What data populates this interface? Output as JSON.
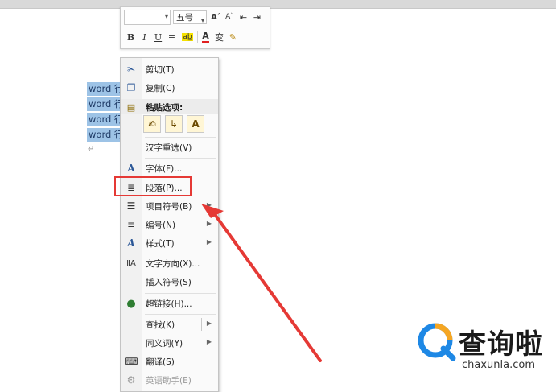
{
  "document": {
    "lines": [
      "word 行",
      "word 行",
      "word 行",
      "word 行"
    ],
    "paragraph_mark": "↵"
  },
  "mini_toolbar": {
    "font_value": "",
    "size_value": "五号",
    "row1_buttons": [
      {
        "name": "grow-font-button",
        "glyph": "A˄"
      },
      {
        "name": "shrink-font-button",
        "glyph": "A˅"
      },
      {
        "name": "decrease-indent-button",
        "glyph": "⇤"
      },
      {
        "name": "increase-indent-button",
        "glyph": "⇥"
      }
    ],
    "row2_buttons": [
      {
        "name": "bold-button",
        "glyph": "B"
      },
      {
        "name": "italic-button",
        "glyph": "I"
      },
      {
        "name": "underline-button",
        "glyph": "U"
      },
      {
        "name": "center-button",
        "glyph": "≡"
      },
      {
        "name": "highlight-button",
        "glyph": "ab̲"
      },
      {
        "name": "font-color-button",
        "glyph": "A"
      },
      {
        "name": "phonetic-button",
        "glyph": "变"
      },
      {
        "name": "format-painter-button",
        "glyph": "✎"
      }
    ],
    "accent_yellow": "#f5e100",
    "accent_red": "#e02020"
  },
  "context_menu": {
    "items": [
      {
        "label": "剪切(T)",
        "icon": "scissors-icon",
        "glyph": "✂"
      },
      {
        "label": "复制(C)",
        "icon": "copy-icon",
        "glyph": "❐"
      },
      {
        "label": "粘贴选项:",
        "icon": "paste-icon",
        "glyph": "▤"
      },
      {
        "label": "汉字重选(V)"
      },
      {
        "label": "字体(F)...",
        "icon": "font-icon",
        "glyph": "A"
      },
      {
        "label": "段落(P)...",
        "icon": "paragraph-icon",
        "glyph": "≣"
      },
      {
        "label": "项目符号(B)",
        "icon": "bullets-icon",
        "glyph": "☰",
        "submenu": true
      },
      {
        "label": "编号(N)",
        "icon": "numbering-icon",
        "glyph": "≡",
        "submenu": true
      },
      {
        "label": "样式(T)",
        "icon": "styles-icon",
        "glyph": "A",
        "submenu": true
      },
      {
        "label": "文字方向(X)...",
        "icon": "text-direction-icon",
        "glyph": "ⅡA"
      },
      {
        "label": "插入符号(S)"
      },
      {
        "label": "超链接(H)...",
        "icon": "hyperlink-icon",
        "glyph": "●"
      },
      {
        "label": "查找(K)",
        "submenu": true
      },
      {
        "label": "同义词(Y)",
        "submenu": true
      },
      {
        "label": "翻译(S)",
        "icon": "translate-icon",
        "glyph": "⌨"
      },
      {
        "label": "英语助手(E)",
        "icon": "english-assistant-icon",
        "glyph": "⚙",
        "disabled": true
      }
    ],
    "paste_buttons": [
      {
        "name": "paste-keep-formatting-icon",
        "glyph": "✍"
      },
      {
        "name": "paste-merge-formatting-icon",
        "glyph": "↳"
      },
      {
        "name": "paste-text-only-icon",
        "glyph": "A"
      }
    ],
    "highlight_color": "#e53935"
  },
  "watermark": {
    "title": "查询啦",
    "url": "chaxunla.com",
    "logo_orange": "#f5a623",
    "logo_blue": "#1e88e5"
  }
}
